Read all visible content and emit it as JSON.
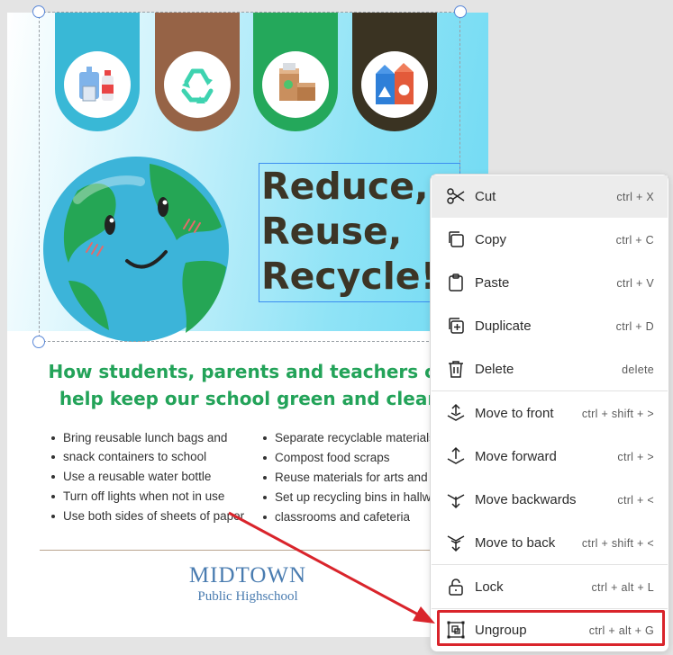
{
  "colors": {
    "tab_blue": "#39b8d6",
    "tab_brown": "#966346",
    "tab_green": "#24a85b",
    "tab_dark": "#3a3322",
    "headline": "#3c3526",
    "subhead": "#23a359",
    "school": "#4a7cb0",
    "annotation_red": "#d9242b"
  },
  "poster": {
    "tabs": [
      {
        "icon": "plastic-bottles-icon"
      },
      {
        "icon": "recycle-icon"
      },
      {
        "icon": "cardboard-boxes-icon"
      },
      {
        "icon": "milk-cartons-icon"
      }
    ],
    "headline": [
      "Reduce,",
      "Reuse,",
      "Recycle!"
    ],
    "subhead": [
      "How students, parents and teachers ca",
      "help keep our school green and clear"
    ],
    "bullets_left": [
      "Bring reusable lunch bags and",
      "snack containers to school",
      "Use a reusable water bottle",
      "Turn off lights when not in use",
      "Use both sides of sheets of paper"
    ],
    "bullets_right": [
      "Separate recyclable materials",
      "Compost food scraps",
      "Reuse materials for arts and cr",
      "Set up recycling bins in hallwa",
      "classrooms and cafeteria"
    ],
    "school_name": "MIDTOWN",
    "school_sub": "Public Highschool"
  },
  "context_menu": {
    "items": [
      {
        "label": "Cut",
        "shortcut": "ctrl + X",
        "icon": "scissors-icon"
      },
      {
        "label": "Copy",
        "shortcut": "ctrl + C",
        "icon": "copy-icon"
      },
      {
        "label": "Paste",
        "shortcut": "ctrl + V",
        "icon": "clipboard-icon"
      },
      {
        "label": "Duplicate",
        "shortcut": "ctrl + D",
        "icon": "duplicate-icon"
      },
      {
        "label": "Delete",
        "shortcut": "delete",
        "icon": "trash-icon"
      },
      {
        "label": "Move to front",
        "shortcut": "ctrl + shift + >",
        "icon": "move-to-front-icon"
      },
      {
        "label": "Move forward",
        "shortcut": "ctrl + >",
        "icon": "move-forward-icon"
      },
      {
        "label": "Move backwards",
        "shortcut": "ctrl + <",
        "icon": "move-backwards-icon"
      },
      {
        "label": "Move to back",
        "shortcut": "ctrl + shift + <",
        "icon": "move-to-back-icon"
      },
      {
        "label": "Lock",
        "shortcut": "ctrl + alt + L",
        "icon": "lock-icon"
      },
      {
        "label": "Ungroup",
        "shortcut": "ctrl + alt + G",
        "icon": "ungroup-icon"
      }
    ]
  }
}
